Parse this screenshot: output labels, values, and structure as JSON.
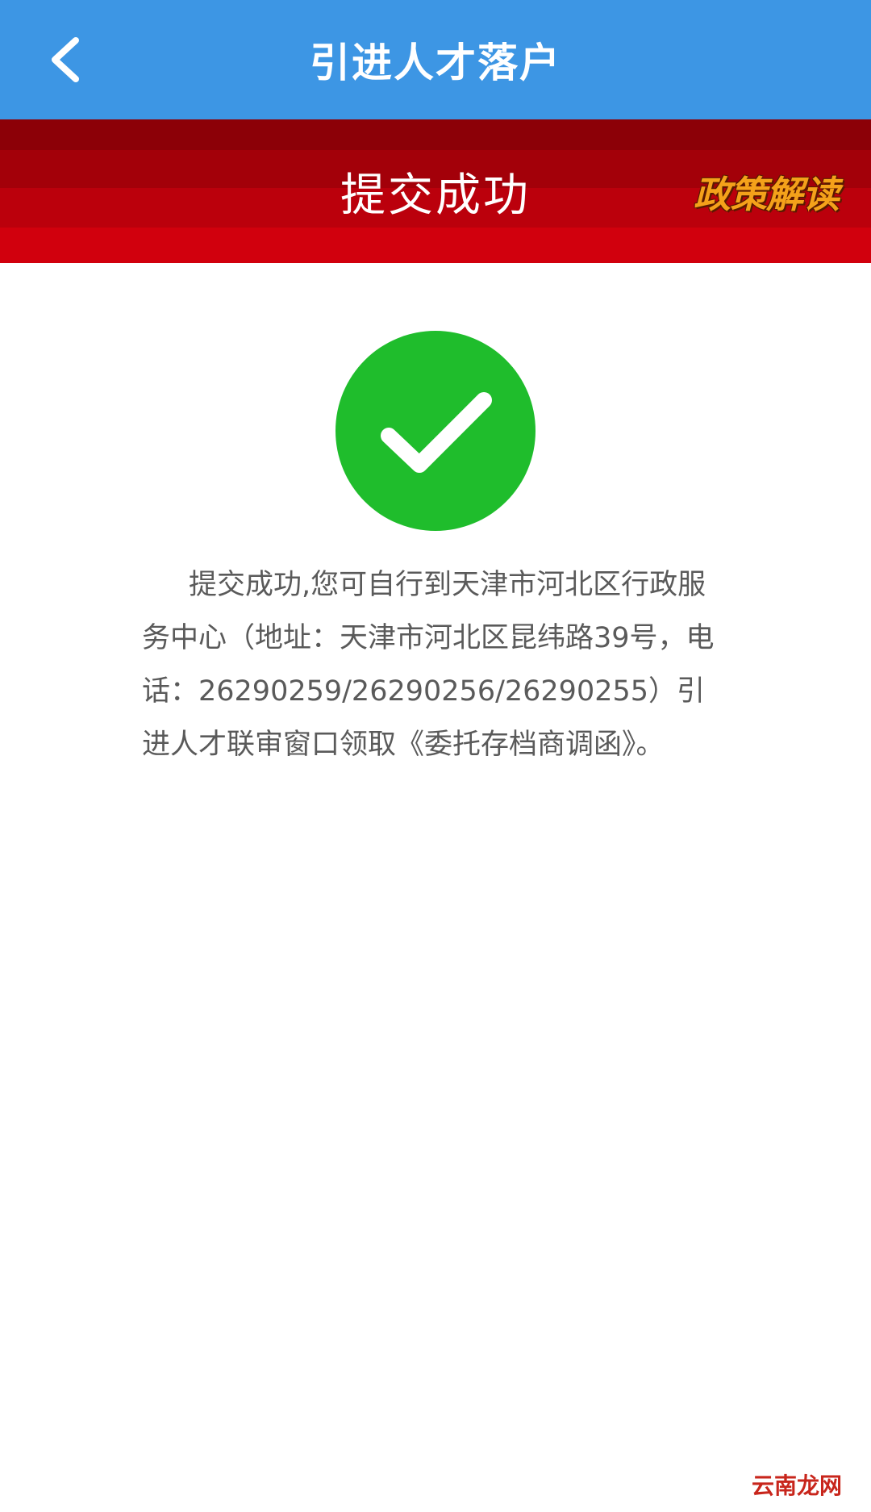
{
  "app_bar": {
    "title": "引进人才落户",
    "back_icon": "chevron-left-icon"
  },
  "banner": {
    "title": "提交成功",
    "policy_link": "政策解读"
  },
  "status": {
    "icon": "check-circle-icon",
    "color": "#1fbd2c"
  },
  "message": "提交成功,您可自行到天津市河北区行政服务中心（地址：天津市河北区昆纬路39号，电话：26290259/26290256/26290255）引进人才联审窗口领取《委托存档商调函》。",
  "watermark": "云南龙网"
}
